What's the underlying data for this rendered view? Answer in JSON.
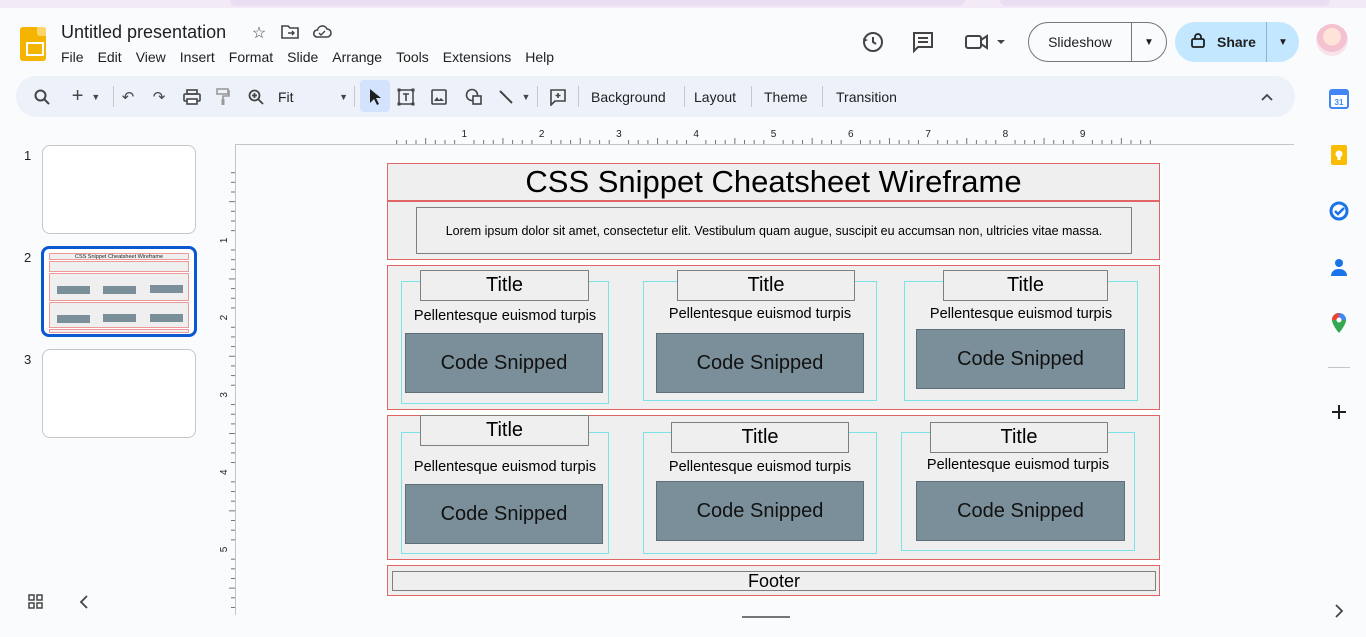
{
  "app": {
    "doc_title": "Untitled presentation",
    "menu": [
      "File",
      "Edit",
      "View",
      "Insert",
      "Format",
      "Slide",
      "Arrange",
      "Tools",
      "Extensions",
      "Help"
    ],
    "slideshow_label": "Slideshow",
    "share_label": "Share"
  },
  "toolbar": {
    "zoom_label": "Fit",
    "background_label": "Background",
    "layout_label": "Layout",
    "theme_label": "Theme",
    "transition_label": "Transition"
  },
  "filmstrip": {
    "slides": [
      {
        "number": "1"
      },
      {
        "number": "2",
        "title": "CSS Snippet Cheatsheet Wireframe",
        "footer": "Footer",
        "card_title": "Title",
        "card_text": "Pellentesque euismod turpis",
        "card_code": "Code Snipped"
      },
      {
        "number": "3"
      }
    ]
  },
  "rulers": {
    "top_ticks": [
      "1",
      "2",
      "3",
      "4",
      "5",
      "6",
      "7",
      "8",
      "9"
    ],
    "left_ticks": [
      "1",
      "2",
      "3",
      "4",
      "5"
    ]
  },
  "slide": {
    "title": "CSS Snippet Cheatsheet Wireframe",
    "lorem": "Lorem ipsum dolor sit amet, consectetur elit. Vestibulum quam augue, suscipit eu accumsan non, ultricies vitae massa.",
    "footer": "Footer",
    "cards": [
      {
        "title": "Title",
        "text": "Pellentesque euismod turpis",
        "code": "Code Snipped"
      },
      {
        "title": "Title",
        "text": "Pellentesque euismod turpis",
        "code": "Code Snipped"
      },
      {
        "title": "Title",
        "text": "Pellentesque euismod turpis",
        "code": "Code Snipped"
      },
      {
        "title": "Title",
        "text": "Pellentesque euismod turpis",
        "code": "Code Snipped"
      },
      {
        "title": "Title",
        "text": "Pellentesque euismod turpis",
        "code": "Code Snipped"
      },
      {
        "title": "Title",
        "text": "Pellentesque euismod turpis",
        "code": "Code Snipped"
      }
    ]
  },
  "colors": {
    "accent": "#0b57d0",
    "share_bg": "#c2e7ff",
    "slides_yellow": "#f4b400",
    "section_border": "#e06666",
    "card_border": "#7be3e6",
    "code_fill": "#7a8f99"
  },
  "icons": [
    "slides-logo",
    "star-icon",
    "move-icon",
    "cloud-icon",
    "history-icon",
    "comment-icon",
    "meet-icon",
    "lock-icon",
    "search-icon",
    "plus-icon",
    "undo-icon",
    "redo-icon",
    "print-icon",
    "paint-format-icon",
    "zoom-icon",
    "select-icon",
    "textbox-icon",
    "image-icon",
    "shape-icon",
    "line-icon",
    "add-comment-icon",
    "collapse-icon",
    "grid-view-icon",
    "chevron-left-icon",
    "calendar-icon",
    "keep-icon",
    "tasks-icon",
    "contacts-icon",
    "maps-icon",
    "add-icon",
    "chevron-right-icon"
  ]
}
